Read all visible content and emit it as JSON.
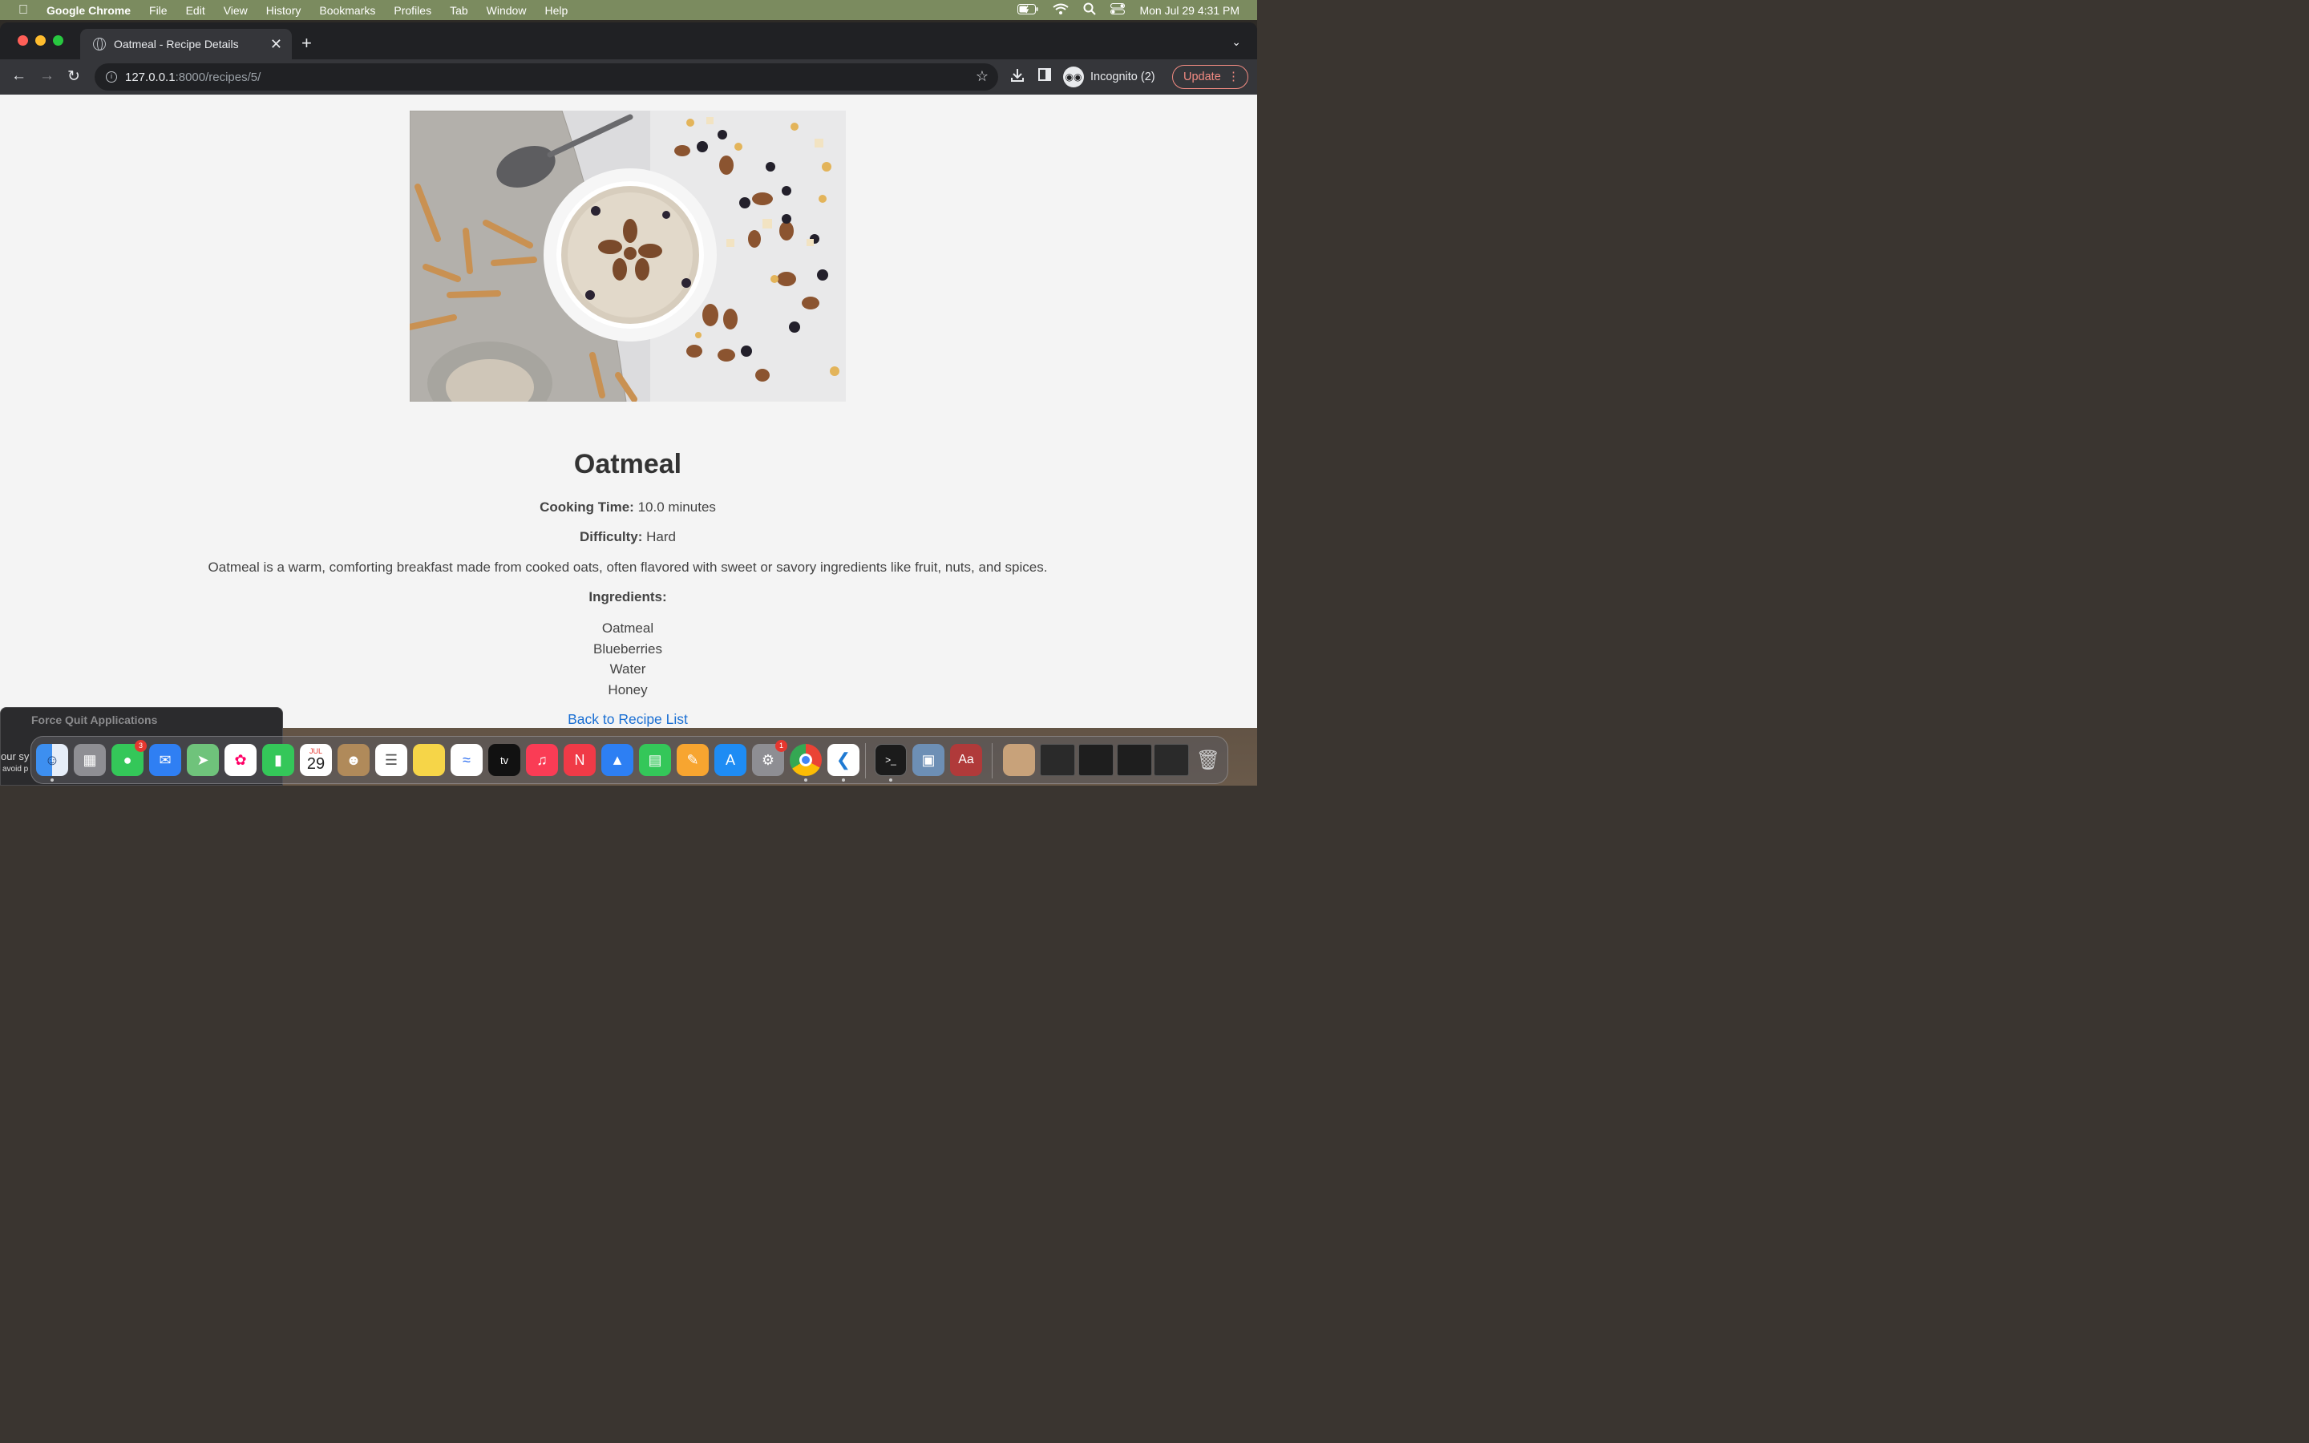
{
  "menubar": {
    "app_name": "Google Chrome",
    "items": [
      "File",
      "Edit",
      "View",
      "History",
      "Bookmarks",
      "Profiles",
      "Tab",
      "Window",
      "Help"
    ],
    "clock": "Mon Jul 29  4:31 PM"
  },
  "browser": {
    "tab_title": "Oatmeal - Recipe Details",
    "url_host": "127.0.0.1",
    "url_path": ":8000/recipes/5/",
    "incognito_label": "Incognito (2)",
    "update_label": "Update"
  },
  "recipe": {
    "title": "Oatmeal",
    "cooking_time_label": "Cooking Time:",
    "cooking_time_value": "10.0 minutes",
    "difficulty_label": "Difficulty:",
    "difficulty_value": "Hard",
    "description": "Oatmeal is a warm, comforting breakfast made from cooked oats, often flavored with sweet or savory ingredients like fruit, nuts, and spices.",
    "ingredients_label": "Ingredients:",
    "ingredients": [
      "Oatmeal",
      "Blueberries",
      "Water",
      "Honey"
    ],
    "back_link": "Back to Recipe List"
  },
  "force_quit": {
    "title": "Force Quit Applications",
    "text1": "our sy",
    "text2": "avoid p"
  },
  "dock": {
    "calendar_month": "JUL",
    "calendar_day": "29",
    "messages_badge": "3",
    "settings_badge": "1",
    "tv_label": "tv",
    "dictionary_label": "Aa"
  }
}
